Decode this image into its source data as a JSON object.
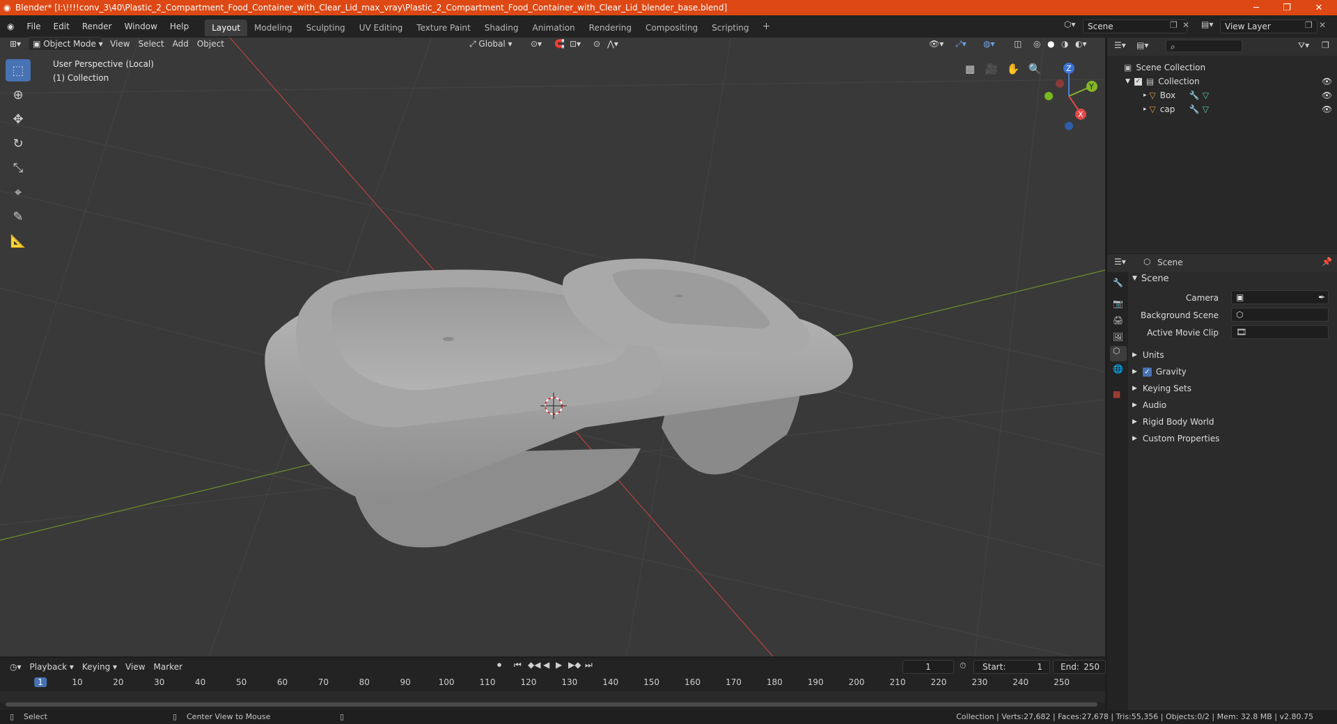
{
  "app": {
    "title": "Blender* [I:\\!!!!conv_3\\40\\Plastic_2_Compartment_Food_Container_with_Clear_Lid_max_vray\\Plastic_2_Compartment_Food_Container_with_Clear_Lid_blender_base.blend]",
    "accent": "#dd4814"
  },
  "menu": [
    "File",
    "Edit",
    "Render",
    "Window",
    "Help"
  ],
  "workspaces": [
    "Layout",
    "Modeling",
    "Sculpting",
    "UV Editing",
    "Texture Paint",
    "Shading",
    "Animation",
    "Rendering",
    "Compositing",
    "Scripting"
  ],
  "active_workspace": "Layout",
  "scene_selector": "Scene",
  "view_layer": "View Layer",
  "viewport_header": {
    "mode": "Object Mode",
    "menus": [
      "View",
      "Select",
      "Add",
      "Object"
    ],
    "transform_orientation": "Global"
  },
  "viewport": {
    "perspective": "User Perspective (Local)",
    "collection": "(1) Collection",
    "gizmo_axes": [
      "Z",
      "Y",
      "X"
    ]
  },
  "outliner": {
    "root": "Scene Collection",
    "collection": "Collection",
    "objects": [
      "Box",
      "cap"
    ]
  },
  "properties": {
    "tab": "Scene",
    "panel": "Scene",
    "fields": [
      {
        "label": "Camera",
        "value": ""
      },
      {
        "label": "Background Scene",
        "value": ""
      },
      {
        "label": "Active Movie Clip",
        "value": ""
      }
    ],
    "sections": [
      "Units",
      "Gravity",
      "Keying Sets",
      "Audio",
      "Rigid Body World",
      "Custom Properties"
    ],
    "gravity_checked": true
  },
  "timeline": {
    "menus": [
      "Playback",
      "Keying",
      "View",
      "Marker"
    ],
    "current_frame": "1",
    "start_label": "Start:",
    "start": "1",
    "end_label": "End:",
    "end": "250",
    "ticks": [
      "1",
      "10",
      "20",
      "30",
      "40",
      "50",
      "60",
      "70",
      "80",
      "90",
      "100",
      "110",
      "120",
      "130",
      "140",
      "150",
      "160",
      "170",
      "180",
      "190",
      "200",
      "210",
      "220",
      "230",
      "240",
      "250"
    ]
  },
  "statusbar": {
    "select": "Select",
    "center": "Center View to Mouse",
    "stats": "Collection | Verts:27,682 | Faces:27,678 | Tris:55,356 | Objects:0/2 | Mem: 32.8 MB | v2.80.75"
  }
}
